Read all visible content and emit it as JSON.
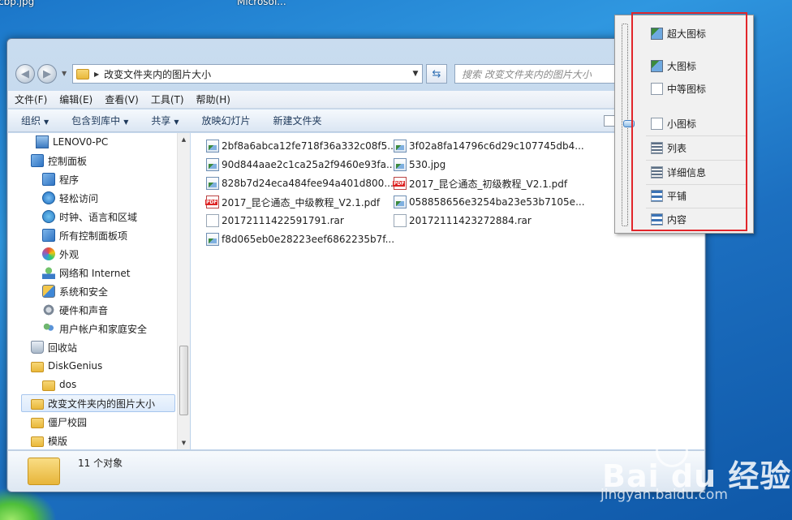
{
  "desktop": {
    "label_left": "cbp.jpg",
    "label_right": "Microsof...",
    "watermark": "Bai du 经验",
    "watermark_url": "jingyan.baidu.com"
  },
  "address_bar": {
    "path": "改变文件夹内的图片大小",
    "search_placeholder": "搜索 改变文件夹内的图片大小"
  },
  "menubar": [
    "文件(F)",
    "编辑(E)",
    "查看(V)",
    "工具(T)",
    "帮助(H)"
  ],
  "toolbar": {
    "organize": "组织",
    "include": "包含到库中",
    "share": "共享",
    "slideshow": "放映幻灯片",
    "new_folder": "新建文件夹"
  },
  "nav": [
    {
      "label": "LENOV0-PC",
      "icon": "computer-icon"
    },
    {
      "label": "控制面板",
      "icon": "control-panel-icon"
    },
    {
      "label": "程序",
      "icon": "programs-icon"
    },
    {
      "label": "轻松访问",
      "icon": "ease-of-access-icon"
    },
    {
      "label": "时钟、语言和区域",
      "icon": "clock-globe-icon"
    },
    {
      "label": "所有控制面板项",
      "icon": "control-panel-icon"
    },
    {
      "label": "外观",
      "icon": "appearance-icon"
    },
    {
      "label": "网络和 Internet",
      "icon": "network-icon"
    },
    {
      "label": "系统和安全",
      "icon": "security-icon"
    },
    {
      "label": "硬件和声音",
      "icon": "hardware-icon"
    },
    {
      "label": "用户帐户和家庭安全",
      "icon": "users-icon"
    },
    {
      "label": "回收站",
      "icon": "recycle-bin-icon"
    },
    {
      "label": "DiskGenius",
      "icon": "folder-icon"
    },
    {
      "label": "dos",
      "icon": "folder-icon"
    },
    {
      "label": "改变文件夹内的图片大小",
      "icon": "folder-icon"
    },
    {
      "label": "僵尸校园",
      "icon": "folder-icon"
    },
    {
      "label": "模版",
      "icon": "folder-icon"
    }
  ],
  "files": [
    {
      "name": "2bf8a6abca12fe718f36a332c08f5...",
      "type": "image"
    },
    {
      "name": "3f02a8fa14796c6d29c107745db4...",
      "type": "image"
    },
    {
      "name": "90d844aae2c1ca25a2f9460e93fa...",
      "type": "image"
    },
    {
      "name": "530.jpg",
      "type": "image"
    },
    {
      "name": "828b7d24eca484fee94a401d800...",
      "type": "image"
    },
    {
      "name": "2017_昆仑通态_初级教程_V2.1.pdf",
      "type": "pdf"
    },
    {
      "name": "2017_昆仑通态_中级教程_V2.1.pdf",
      "type": "pdf"
    },
    {
      "name": "058858656e3254ba23e53b7105e...",
      "type": "image"
    },
    {
      "name": "20172111422591791.rar",
      "type": "rar"
    },
    {
      "name": "20172111423272884.rar",
      "type": "rar"
    },
    {
      "name": "f8d065eb0e28223eef6862235b7f...",
      "type": "image"
    }
  ],
  "status": {
    "count": "11 个对象"
  },
  "view_menu": [
    {
      "label": "超大图标",
      "icon": "extra-large-icons-icon"
    },
    {
      "label": "大图标",
      "icon": "large-icons-icon"
    },
    {
      "label": "中等图标",
      "icon": "medium-icons-icon"
    },
    {
      "label": "小图标",
      "icon": "small-icons-icon"
    },
    {
      "label": "列表",
      "icon": "list-icon"
    },
    {
      "label": "详细信息",
      "icon": "details-icon"
    },
    {
      "label": "平铺",
      "icon": "tiles-icon"
    },
    {
      "label": "内容",
      "icon": "content-icon"
    }
  ],
  "colors": {
    "highlight": "#e2262b",
    "selection": "#dceafb"
  }
}
